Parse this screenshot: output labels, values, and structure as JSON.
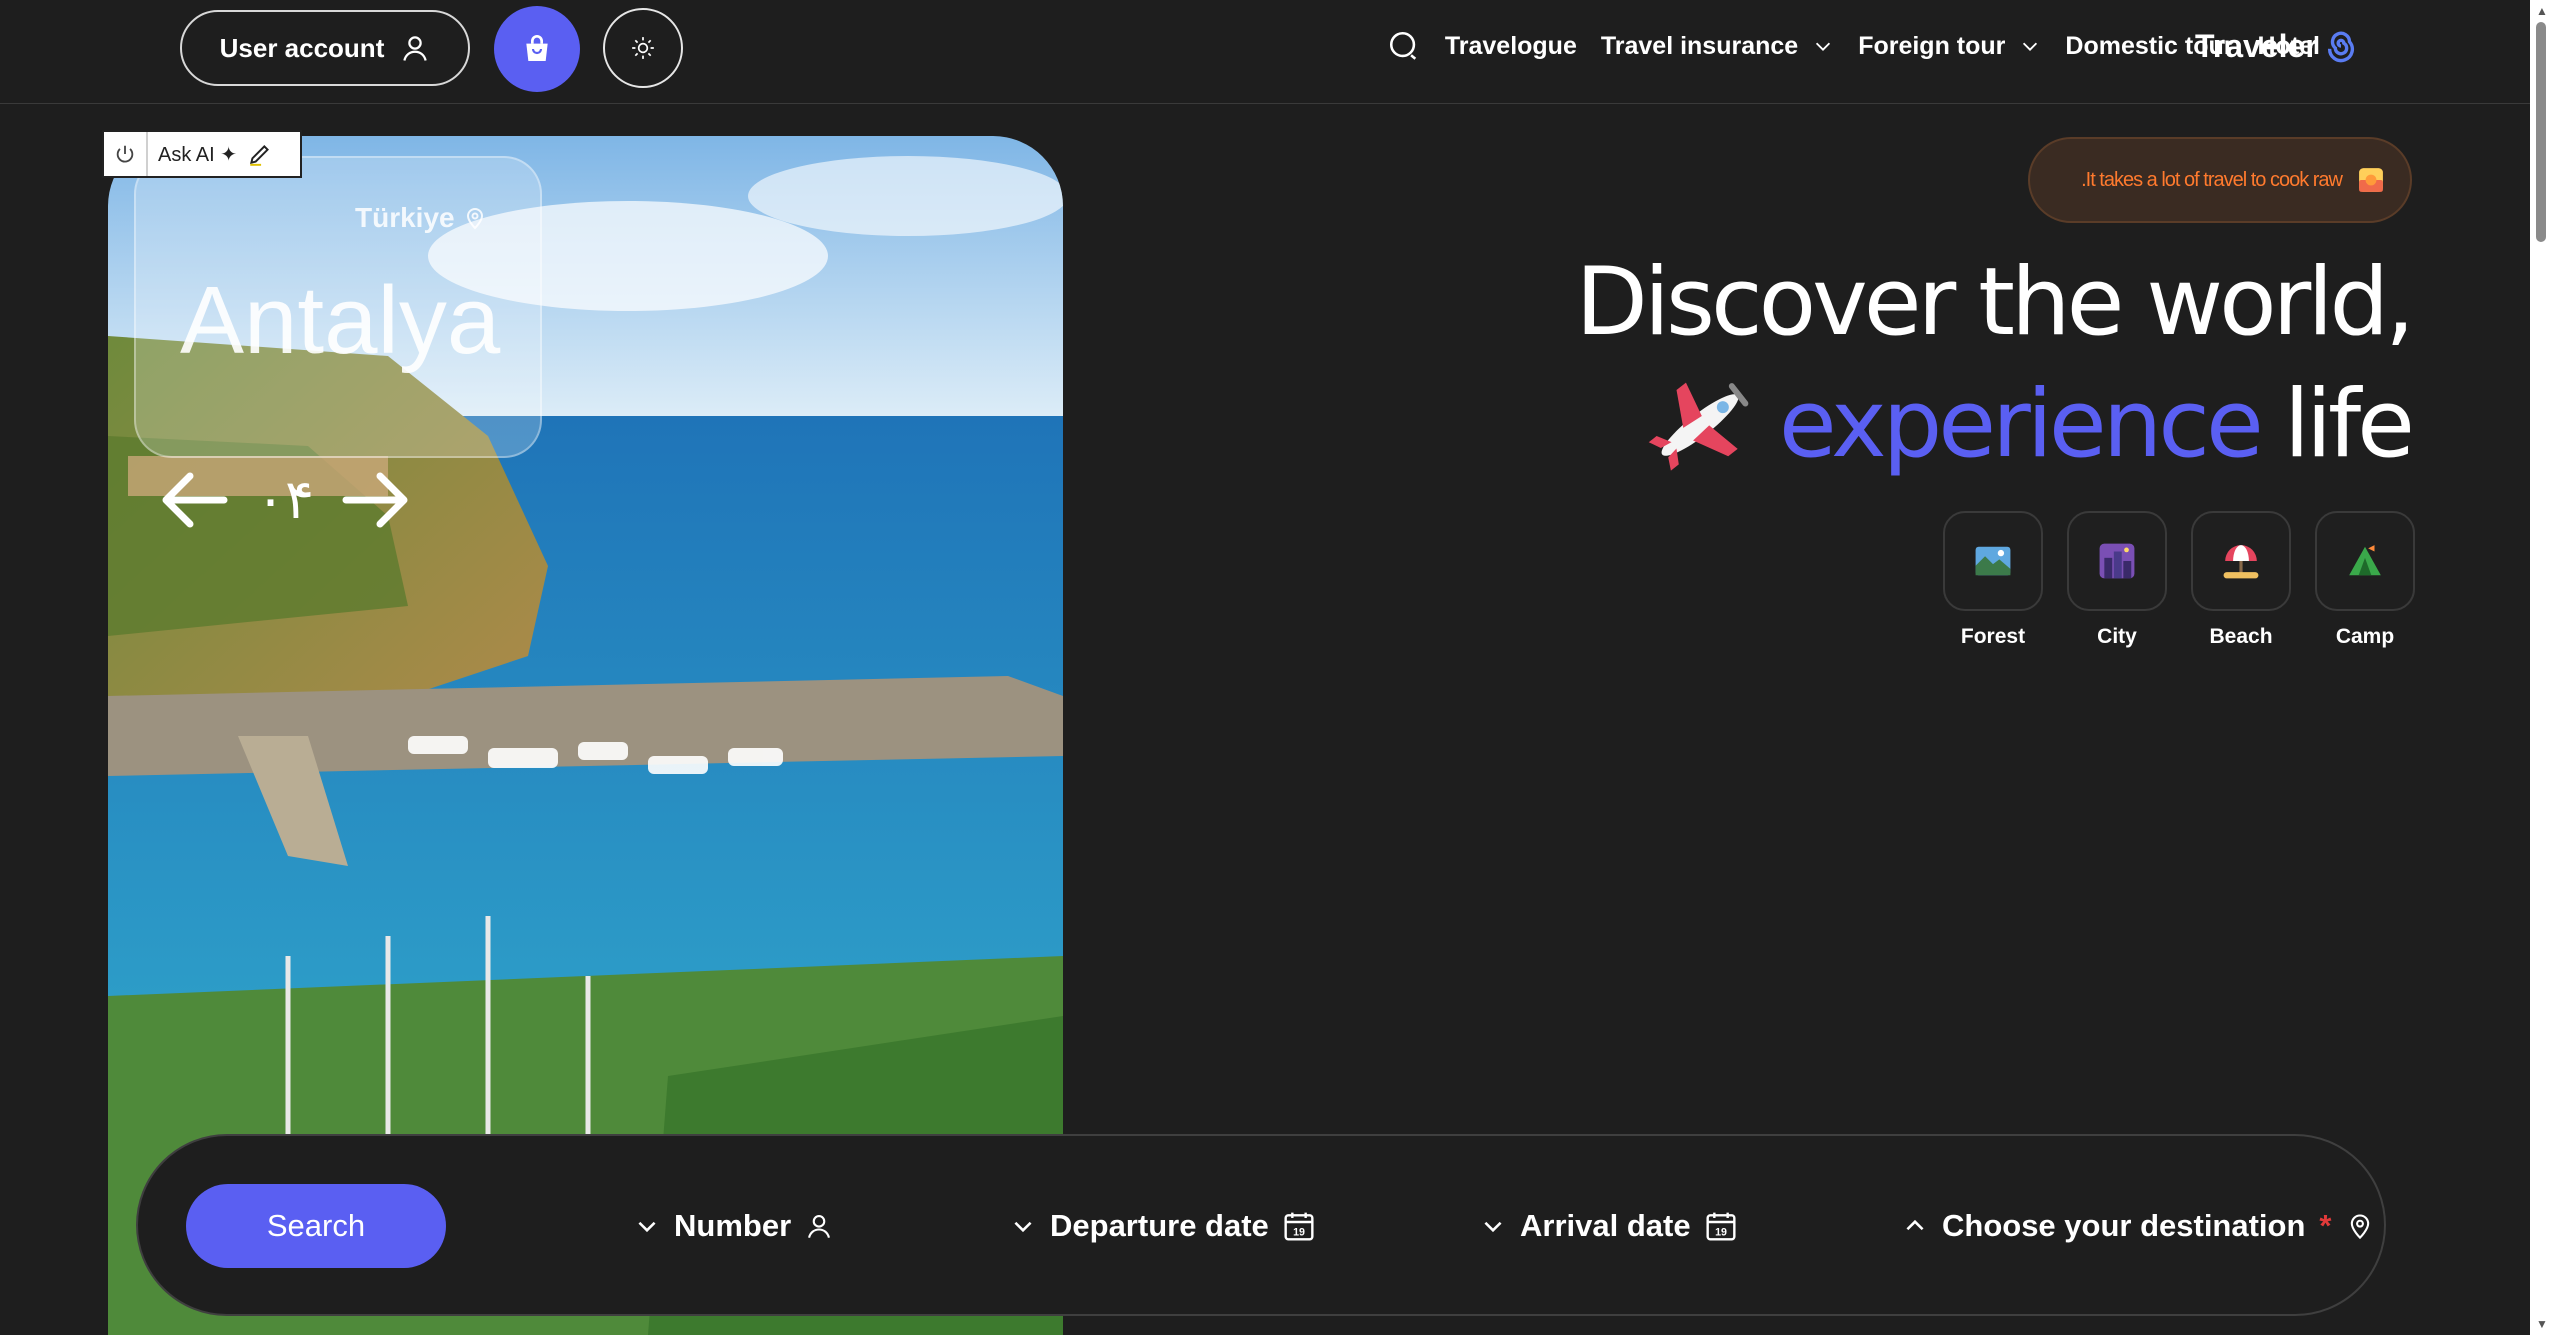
{
  "header": {
    "account_label": "User account",
    "nav": {
      "travelogue": "Travelogue",
      "travel_insurance": "Travel insurance",
      "foreign_tour": "Foreign tour",
      "domestic_tour": "Domestic tour",
      "hotel": "Hotel"
    },
    "brand": "Traveler",
    "icons": [
      "user-icon",
      "shopping-bag-icon",
      "sun-icon",
      "search-icon",
      "chevron-down-icon",
      "spiral-icon"
    ]
  },
  "ai_widget": {
    "label": "Ask AI ✦"
  },
  "hero": {
    "country": "Türkiye",
    "city": "Antalya",
    "counter": "٠۴"
  },
  "quote": ".It takes a lot of travel to cook raw",
  "headline": {
    "line1": "Discover the world,",
    "accent": "experience",
    "word": "life"
  },
  "categories": [
    {
      "label": "Forest"
    },
    {
      "label": "City"
    },
    {
      "label": "Beach"
    },
    {
      "label": "Camp"
    }
  ],
  "search": {
    "button_label": "Search",
    "number_label": "Number",
    "departure_label": "Departure date",
    "arrival_label": "Arrival date",
    "calendar_day": "19",
    "destination_label": "Choose your destination",
    "required_mark": "*"
  },
  "colors": {
    "accent": "#5a5ff2",
    "background": "#1e1e1e",
    "quote_text": "#ff7a2e",
    "required": "#e23a3a"
  }
}
